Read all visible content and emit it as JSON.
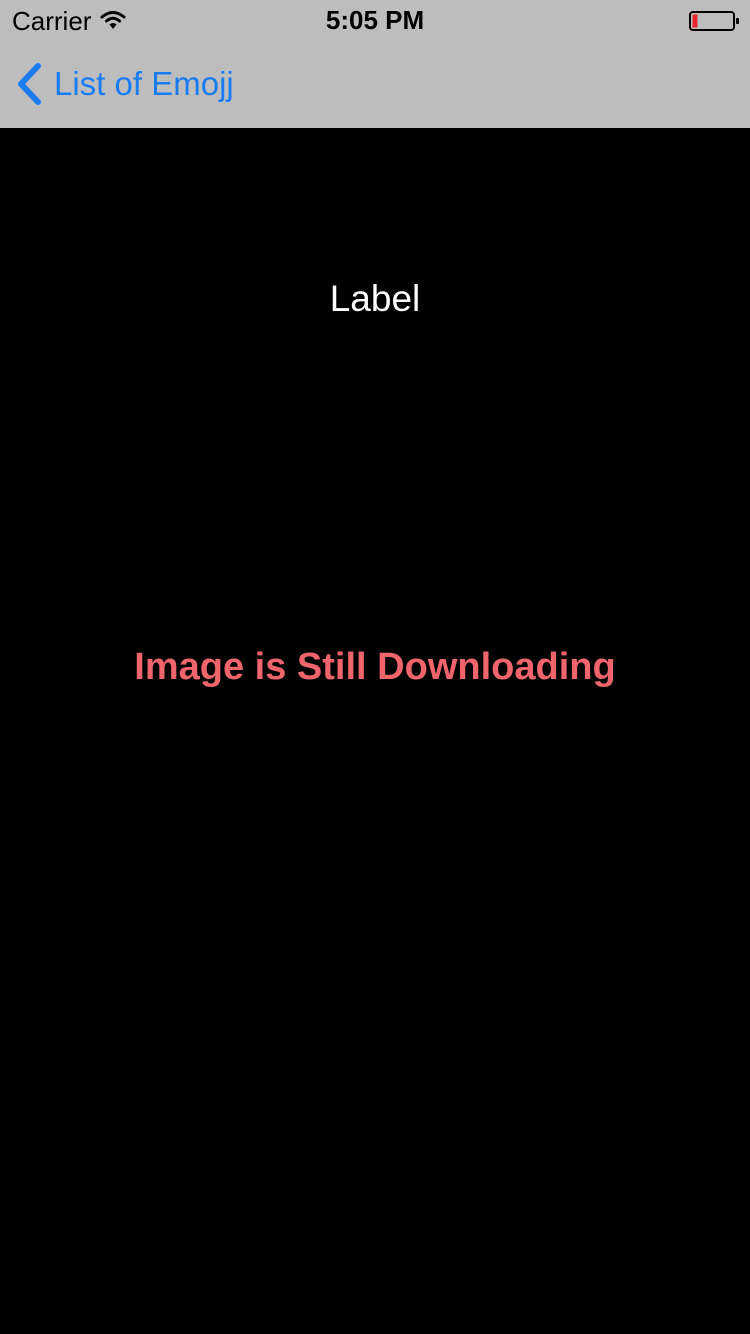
{
  "status_bar": {
    "carrier": "Carrier",
    "time": "5:05 PM",
    "wifi_icon": "wifi-icon",
    "battery_icon": "battery-low-icon"
  },
  "nav": {
    "back_label": "List of Emojj",
    "back_icon": "chevron-left-icon"
  },
  "content": {
    "label": "Label",
    "status_message": "Image is Still Downloading"
  },
  "colors": {
    "nav_background": "#bdbdbd",
    "background": "#000000",
    "accent": "#1a7cf5",
    "status_message": "#f0646c",
    "battery_low": "#e8252c"
  }
}
